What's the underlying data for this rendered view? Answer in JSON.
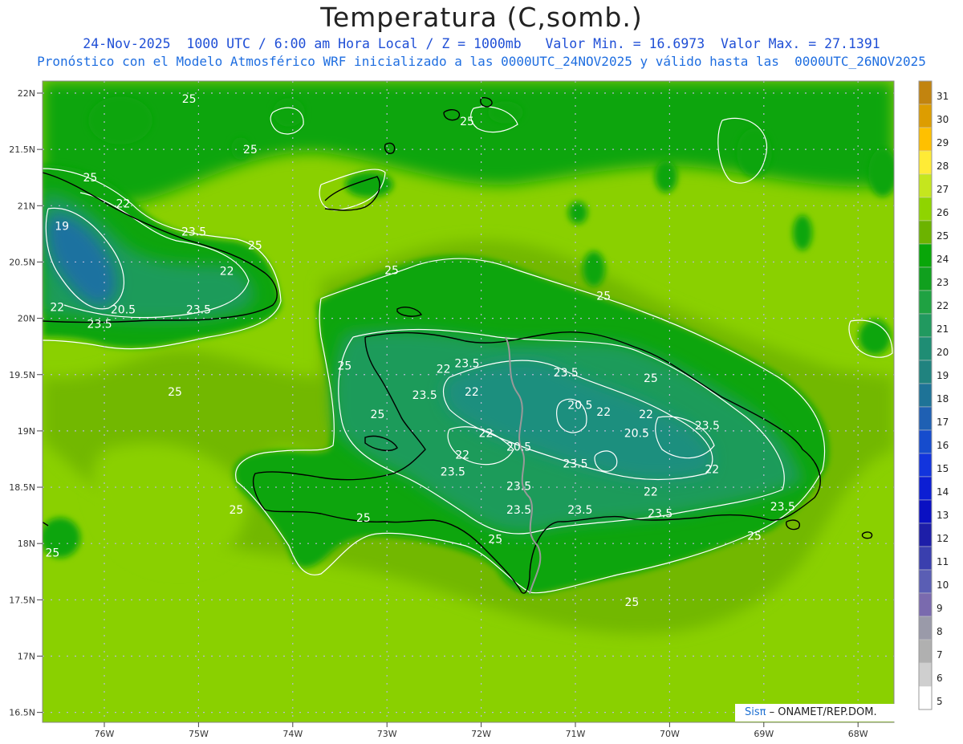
{
  "header": {
    "title": "Temperatura (C,somb.)",
    "subtitle_line1": "24-Nov-2025  1000 UTC / 6:00 am Hora Local / Z = 1000mb   Valor Min. = 16.6973  Valor Max. = 27.1391",
    "subtitle_line2": "Pronóstico con el Modelo Atmosférico WRF inicializado a las 0000UTC_24NOV2025 y válido hasta las  0000UTC_26NOV2025"
  },
  "map": {
    "lat_labels": [
      "22N",
      "21.5N",
      "21N",
      "20.5N",
      "20N",
      "19.5N",
      "19N",
      "18.5N",
      "18N",
      "17.5N",
      "17N",
      "16.5N"
    ],
    "lon_labels": [
      "76W",
      "75W",
      "74W",
      "73W",
      "72W",
      "71W",
      "70W",
      "69W",
      "68W"
    ],
    "contour_labels": [
      {
        "text": "25",
        "lon": -75.1,
        "lat": 21.95
      },
      {
        "text": "25",
        "lon": -72.15,
        "lat": 21.75
      },
      {
        "text": "25",
        "lon": -74.45,
        "lat": 21.5
      },
      {
        "text": "25",
        "lon": -76.15,
        "lat": 21.25
      },
      {
        "text": "22",
        "lon": -75.8,
        "lat": 21.02
      },
      {
        "text": "19",
        "lon": -76.45,
        "lat": 20.82
      },
      {
        "text": "23.5",
        "lon": -75.05,
        "lat": 20.77
      },
      {
        "text": "25",
        "lon": -74.4,
        "lat": 20.65
      },
      {
        "text": "22",
        "lon": -74.7,
        "lat": 20.42
      },
      {
        "text": "22",
        "lon": -76.5,
        "lat": 20.1
      },
      {
        "text": "20.5",
        "lon": -75.8,
        "lat": 20.08
      },
      {
        "text": "23.5",
        "lon": -75.0,
        "lat": 20.08
      },
      {
        "text": "23.5",
        "lon": -76.05,
        "lat": 19.95
      },
      {
        "text": "25",
        "lon": -72.95,
        "lat": 20.43
      },
      {
        "text": "25",
        "lon": -70.7,
        "lat": 20.2
      },
      {
        "text": "25",
        "lon": -75.25,
        "lat": 19.35
      },
      {
        "text": "25",
        "lon": -73.1,
        "lat": 19.15
      },
      {
        "text": "25",
        "lon": -73.45,
        "lat": 19.58
      },
      {
        "text": "23.5",
        "lon": -72.15,
        "lat": 19.6
      },
      {
        "text": "22",
        "lon": -72.4,
        "lat": 19.55
      },
      {
        "text": "22",
        "lon": -72.1,
        "lat": 19.35
      },
      {
        "text": "23.5",
        "lon": -71.1,
        "lat": 19.52
      },
      {
        "text": "23.5",
        "lon": -72.6,
        "lat": 19.32
      },
      {
        "text": "25",
        "lon": -70.2,
        "lat": 19.47
      },
      {
        "text": "20.5",
        "lon": -70.95,
        "lat": 19.23
      },
      {
        "text": "22",
        "lon": -70.7,
        "lat": 19.17
      },
      {
        "text": "22",
        "lon": -70.25,
        "lat": 19.15
      },
      {
        "text": "23.5",
        "lon": -69.6,
        "lat": 19.05
      },
      {
        "text": "22",
        "lon": -71.95,
        "lat": 18.98
      },
      {
        "text": "20.5",
        "lon": -70.35,
        "lat": 18.98
      },
      {
        "text": "20.5",
        "lon": -71.6,
        "lat": 18.86
      },
      {
        "text": "22",
        "lon": -72.2,
        "lat": 18.79
      },
      {
        "text": "23.5",
        "lon": -71.0,
        "lat": 18.71
      },
      {
        "text": "22",
        "lon": -69.55,
        "lat": 18.66
      },
      {
        "text": "23.5",
        "lon": -72.3,
        "lat": 18.64
      },
      {
        "text": "23.5",
        "lon": -71.6,
        "lat": 18.51
      },
      {
        "text": "22",
        "lon": -70.2,
        "lat": 18.46
      },
      {
        "text": "25",
        "lon": -74.6,
        "lat": 18.3
      },
      {
        "text": "25",
        "lon": -73.25,
        "lat": 18.23
      },
      {
        "text": "23.5",
        "lon": -71.6,
        "lat": 18.3
      },
      {
        "text": "23.5",
        "lon": -70.95,
        "lat": 18.3
      },
      {
        "text": "23.5",
        "lon": -70.1,
        "lat": 18.27
      },
      {
        "text": "23.5",
        "lon": -68.8,
        "lat": 18.33
      },
      {
        "text": "25",
        "lon": -71.85,
        "lat": 18.04
      },
      {
        "text": "25",
        "lon": -69.1,
        "lat": 18.07
      },
      {
        "text": "25",
        "lon": -76.55,
        "lat": 17.92
      },
      {
        "text": "25",
        "lon": -70.4,
        "lat": 17.48
      }
    ],
    "credit": {
      "logo": "Sisπ",
      "text": "– ONAMET/REP.DOM."
    }
  },
  "colorbar": {
    "labels": [
      "31",
      "30",
      "29",
      "28",
      "27",
      "26",
      "25",
      "24",
      "23",
      "22",
      "21",
      "20",
      "19",
      "18",
      "17",
      "16",
      "15",
      "14",
      "13",
      "12",
      "11",
      "10",
      "9",
      "8",
      "7",
      "6",
      "5"
    ],
    "colors": [
      "#c2840f",
      "#dd9d00",
      "#ffc000",
      "#ffeb36",
      "#c5e61e",
      "#8fd400",
      "#6cb300",
      "#09a609",
      "#10a01e",
      "#1fa242",
      "#21995f",
      "#1f8d74",
      "#20837f",
      "#1e7397",
      "#1f60b3",
      "#164ccd",
      "#1234dd",
      "#0c1ed3",
      "#0a10c2",
      "#1d1ea8",
      "#3a3fae",
      "#5a5eb4",
      "#7a6aae",
      "#9a9aa9",
      "#b0b0b0",
      "#cfcfcf",
      "#ffffff"
    ]
  },
  "colors": {
    "sea_far": "#8ad000",
    "sea_near": "#72b800",
    "sea_coastal": "#08a508",
    "land_mid": "#1f9b5a",
    "land_high": "#1c8f7e",
    "cold_core": "#1d72a0",
    "coastline": "#000000",
    "border": "#999999",
    "contour": "#ffffff",
    "title_blue": "#1f4fd6"
  }
}
